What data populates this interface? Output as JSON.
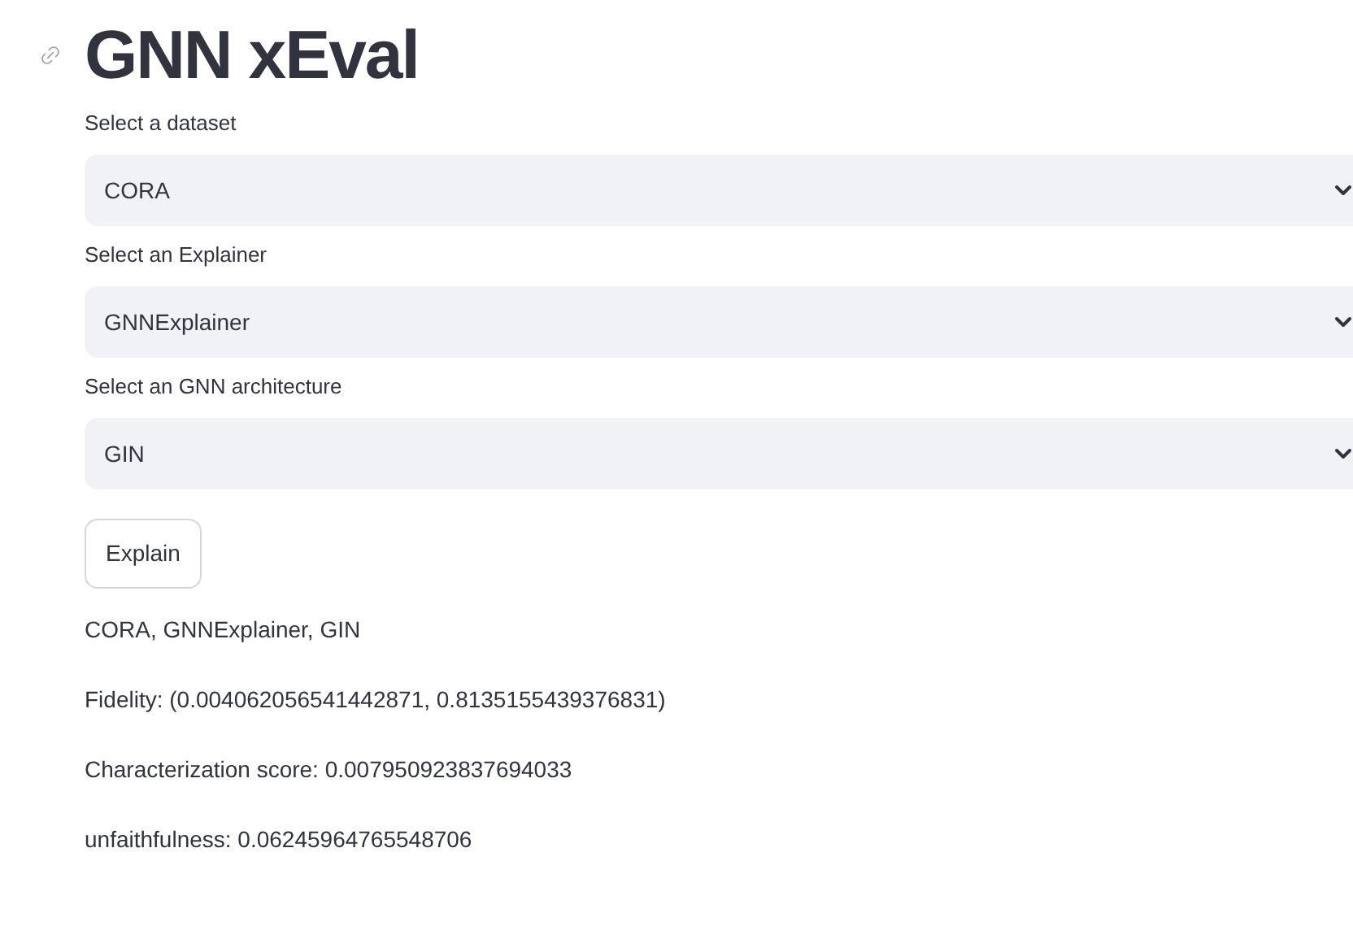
{
  "title": "GNN xEval",
  "selects": [
    {
      "label": "Select a dataset",
      "value": "CORA"
    },
    {
      "label": "Select an Explainer",
      "value": "GNNExplainer"
    },
    {
      "label": "Select an GNN architecture",
      "value": "GIN"
    }
  ],
  "button": "Explain",
  "results": [
    "CORA, GNNExplainer, GIN",
    "Fidelity: (0.004062056541442871, 0.8135155439376831)",
    "Characterization score: 0.007950923837694033",
    "unfaithfulness: 0.06245964765548706"
  ]
}
